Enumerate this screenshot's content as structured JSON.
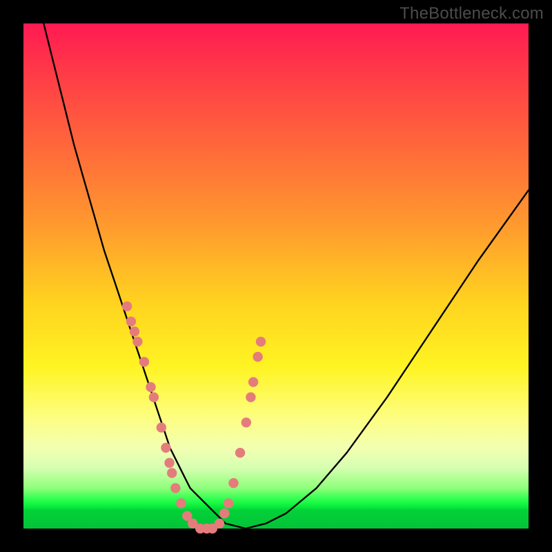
{
  "watermark": "TheBottleneck.com",
  "colors": {
    "dot": "#e57c7c",
    "curve": "#000000",
    "frame": "#000000"
  },
  "chart_data": {
    "type": "line",
    "title": "",
    "xlabel": "",
    "ylabel": "",
    "xlim": [
      0,
      100
    ],
    "ylim": [
      0,
      100
    ],
    "grid": false,
    "series": [
      {
        "name": "bottleneck-curve",
        "x": [
          4,
          6,
          8,
          10,
          12,
          14,
          16,
          18,
          20,
          22,
          24,
          25,
          26,
          27,
          28,
          29,
          30,
          31,
          32,
          33,
          34,
          36,
          38,
          40,
          44,
          48,
          52,
          58,
          64,
          72,
          80,
          90,
          100
        ],
        "y": [
          100,
          92,
          84,
          76,
          69,
          62,
          55,
          49,
          43,
          37,
          31,
          28,
          25,
          22,
          19,
          16,
          14,
          12,
          10,
          8,
          7,
          5,
          3,
          1,
          0,
          1,
          3,
          8,
          15,
          26,
          38,
          53,
          67
        ]
      }
    ],
    "points": [
      {
        "x": 20.5,
        "y": 44
      },
      {
        "x": 21.3,
        "y": 41
      },
      {
        "x": 22.0,
        "y": 39
      },
      {
        "x": 22.6,
        "y": 37
      },
      {
        "x": 23.9,
        "y": 33
      },
      {
        "x": 25.2,
        "y": 28
      },
      {
        "x": 25.8,
        "y": 26
      },
      {
        "x": 27.3,
        "y": 20
      },
      {
        "x": 28.2,
        "y": 16
      },
      {
        "x": 28.9,
        "y": 13
      },
      {
        "x": 29.4,
        "y": 11
      },
      {
        "x": 30.1,
        "y": 8
      },
      {
        "x": 31.2,
        "y": 5
      },
      {
        "x": 32.4,
        "y": 2.5
      },
      {
        "x": 33.5,
        "y": 1
      },
      {
        "x": 35.0,
        "y": 0
      },
      {
        "x": 36.3,
        "y": 0
      },
      {
        "x": 37.4,
        "y": 0
      },
      {
        "x": 38.8,
        "y": 1
      },
      {
        "x": 39.8,
        "y": 3
      },
      {
        "x": 40.6,
        "y": 5
      },
      {
        "x": 41.6,
        "y": 9
      },
      {
        "x": 42.9,
        "y": 15
      },
      {
        "x": 44.1,
        "y": 21
      },
      {
        "x": 45.0,
        "y": 26
      },
      {
        "x": 45.5,
        "y": 29
      },
      {
        "x": 46.4,
        "y": 34
      },
      {
        "x": 47.0,
        "y": 37
      }
    ]
  }
}
